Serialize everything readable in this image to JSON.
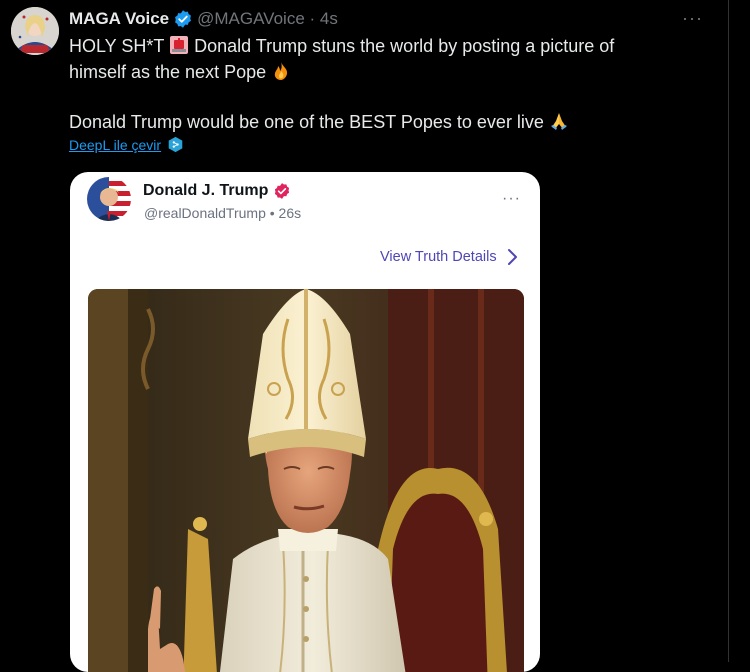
{
  "tweet": {
    "author_name": "MAGA Voice",
    "author_handle": "@MAGAVoice · 4s",
    "line1": "HOLY SH*T",
    "line1_rest": "Donald Trump stuns the world by posting a picture of",
    "line2": "himself as the next Pope",
    "line3": "Donald Trump would be one of the BEST Popes to ever live",
    "more_label": "···"
  },
  "translate": {
    "label": "DeepL ile çevir"
  },
  "card": {
    "name": "Donald J. Trump",
    "handle": "@realDonaldTrump • 26s",
    "more_label": "···",
    "view_details": "View Truth Details"
  },
  "icons": {
    "alarm": "police-light-emoji",
    "fire": "fire-emoji",
    "pray": "folded-hands-emoji",
    "verified": "verified-badge-icon",
    "deepl": "deepl-icon"
  },
  "colors": {
    "background": "#000000",
    "accent": "#1d9bf0",
    "truth_link": "#4f46b5",
    "truth_badge": "#e0245e"
  }
}
